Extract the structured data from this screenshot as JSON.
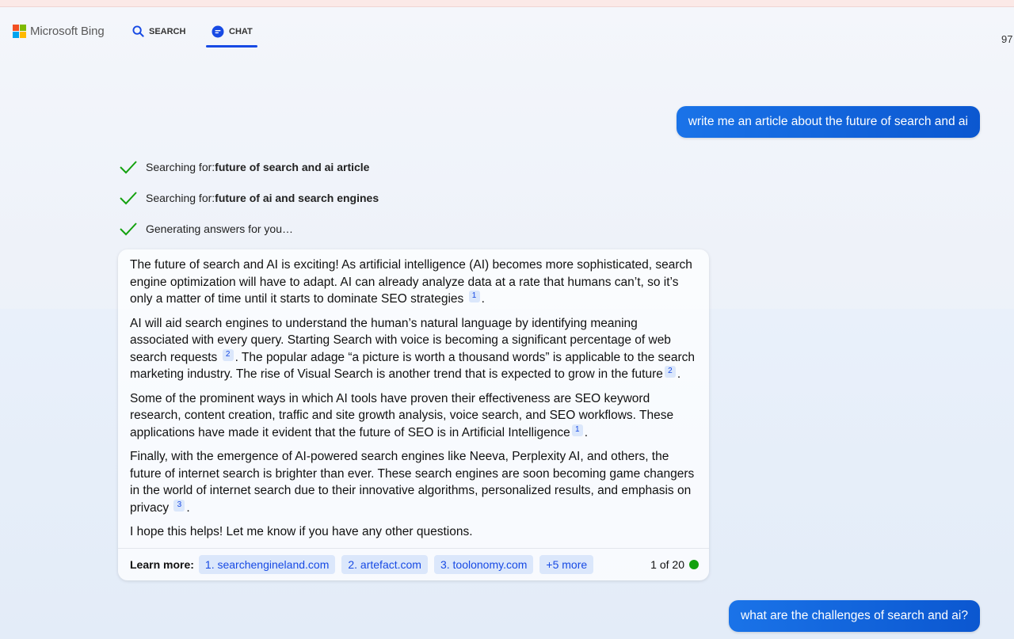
{
  "header": {
    "logo_text": "Microsoft Bing",
    "nav": [
      {
        "label": "SEARCH",
        "icon": "search-icon"
      },
      {
        "label": "CHAT",
        "icon": "chat-icon",
        "active": true
      }
    ],
    "points": "97"
  },
  "colors": {
    "accent": "#174ae4",
    "user_bubble": "#0b57d0",
    "check": "#13a10e",
    "ms_red": "#f25022",
    "ms_green": "#7fba00",
    "ms_blue": "#00a4ef",
    "ms_yellow": "#ffb900"
  },
  "conversation": {
    "user_message_1": "write me an article about the future of search and ai",
    "status": [
      {
        "prefix": "Searching for: ",
        "bold": "future of search and ai article"
      },
      {
        "prefix": "Searching for: ",
        "bold": "future of ai and search engines"
      },
      {
        "prefix": "Generating answers for you…",
        "bold": ""
      }
    ],
    "answer": {
      "p1": "The future of search and AI is exciting! As artificial intelligence (AI) becomes more sophisticated, search engine optimization will have to adapt. AI can already analyze data at a rate that humans can’t, so it’s only a matter of time until it starts to dominate SEO strategies",
      "p1_cite": "1",
      "p2a": "AI will aid search engines to understand the human’s natural language by identifying meaning associated with every query. Starting Search with voice is becoming a significant percentage of web search requests",
      "p2a_cite": "2",
      "p2b": ". The popular adage “a picture is worth a thousand words” is applicable to the search marketing industry. The rise of Visual Search is another trend that is expected to grow in the future",
      "p2b_cite": "2",
      "p3": "Some of the prominent ways in which AI tools have proven their effectiveness are SEO keyword research, content creation, traffic and site growth analysis, voice search, and SEO workflows. These applications have made it evident that the future of SEO is in Artificial Intelligence",
      "p3_cite": "1",
      "p4": "Finally, with the emergence of AI-powered search engines like Neeva, Perplexity AI, and others, the future of internet search is brighter than ever. These search engines are soon becoming game changers in the world of internet search due to their innovative algorithms, personalized results, and emphasis on privacy",
      "p4_cite": "3",
      "p5": "I hope this helps! Let me know if you have any other questions.",
      "period": "."
    },
    "learn_more": {
      "label": "Learn more:",
      "links": [
        "1. searchengineland.com",
        "2. artefact.com",
        "3. toolonomy.com",
        "+5 more"
      ],
      "counter": "1 of 20"
    },
    "user_message_2": "what are the challenges of search and ai?"
  }
}
